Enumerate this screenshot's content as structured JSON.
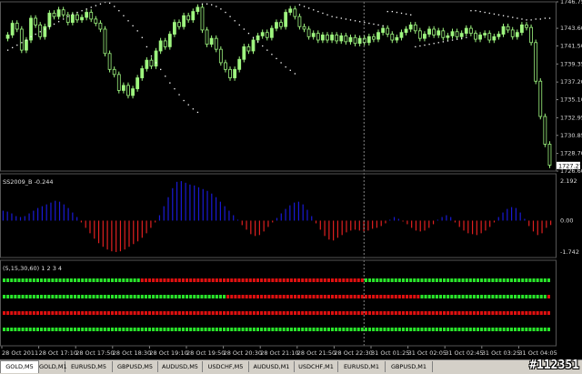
{
  "colors": {
    "background": "#000000",
    "grid": "#555555",
    "candle": "#9ef57f",
    "sar": "#ffffff",
    "histogram_up": "#1a1ad6",
    "histogram_down": "#e02020",
    "dot_green": "#29e62b",
    "dot_red": "#e01010",
    "cursor_line": "#bbbbbb"
  },
  "price_pane": {
    "price_labels": [
      "1746.75",
      "1743.60",
      "1741.50",
      "1739.35",
      "1737.20",
      "1735.10",
      "1732.95",
      "1730.85",
      "1728.70",
      "1726.60"
    ],
    "current_price": "1727.27"
  },
  "indicator_pane": {
    "title": "SS2009_B -0.244",
    "labels": [
      "2.192",
      "0.00",
      "-1.742"
    ]
  },
  "dots_pane": {
    "title": "(5,15,30,60) 1 2 3 4"
  },
  "time_labels": [
    "28 Oct 2011",
    "28 Oct 17:10",
    "28 Oct 17:50",
    "28 Oct 18:30",
    "28 Oct 19:10",
    "28 Oct 19:50",
    "28 Oct 20:30",
    "28 Oct 21:10",
    "28 Oct 21:50",
    "28 Oct 22:30",
    "31 Oct 01:25",
    "31 Oct 02:05",
    "31 Oct 02:45",
    "31 Oct 03:25",
    "31 Oct 04:05"
  ],
  "tabs": [
    {
      "label": "GOLD,M5",
      "active": true
    },
    {
      "label": "GOLD,M1",
      "active": false
    },
    {
      "label": "EURUSD,M5",
      "active": false
    },
    {
      "label": "GBPUSD,M5",
      "active": false
    },
    {
      "label": "AUDUSD,M5",
      "active": false
    },
    {
      "label": "USDCHF,M5",
      "active": false
    },
    {
      "label": "AUDUSD,M1",
      "active": false
    },
    {
      "label": "USDCHF,M1",
      "active": false
    },
    {
      "label": "EURUSD,M1",
      "active": false
    },
    {
      "label": "GBPUSD,M1",
      "active": false
    }
  ],
  "watermark": "#112351",
  "chart_data": {
    "type": "candlestick",
    "y_range": [
      1726.6,
      1746.75
    ],
    "closes": [
      1742.8,
      1744.2,
      1743.5,
      1741.0,
      1742.2,
      1744.8,
      1744.0,
      1742.6,
      1743.8,
      1745.4,
      1745.0,
      1745.8,
      1745.2,
      1744.3,
      1745.2,
      1744.6,
      1744.9,
      1745.5,
      1744.7,
      1744.2,
      1743.5,
      1740.6,
      1738.7,
      1738.1,
      1736.2,
      1736.8,
      1735.6,
      1736.4,
      1737.7,
      1738.8,
      1739.8,
      1739.1,
      1740.9,
      1742.1,
      1741.4,
      1742.9,
      1744.3,
      1743.8,
      1745.1,
      1744.6,
      1745.6,
      1746.1,
      1743.4,
      1741.7,
      1742.4,
      1741.1,
      1739.5,
      1738.7,
      1737.7,
      1738.7,
      1739.9,
      1741.4,
      1740.9,
      1742.2,
      1742.7,
      1743.1,
      1742.5,
      1743.6,
      1744.3,
      1743.8,
      1745.5,
      1745.9,
      1745.0,
      1743.8,
      1743.5,
      1742.6,
      1743.0,
      1742.2,
      1742.8,
      1742.2,
      1742.8,
      1742.1,
      1742.7,
      1742.0,
      1742.5,
      1741.8,
      1742.4,
      1741.9,
      1742.6,
      1742.3,
      1743.1,
      1743.6,
      1742.9,
      1742.2,
      1742.5,
      1743.1,
      1743.5,
      1744.0,
      1743.3,
      1742.4,
      1742.9,
      1743.5,
      1742.8,
      1743.3,
      1742.5,
      1742.7,
      1743.2,
      1742.6,
      1743.0,
      1743.6,
      1743.0,
      1742.3,
      1742.8,
      1743.0,
      1742.2,
      1742.6,
      1742.9,
      1743.8,
      1743.4,
      1742.6,
      1743.1,
      1744.0,
      1743.7,
      1741.9,
      1737.3,
      1733.1,
      1729.8,
      1727.3
    ],
    "sar": [
      1741.0,
      1741.3,
      1741.6,
      1741.9,
      1742.2,
      1742.6,
      1742.9,
      1743.2,
      1743.5,
      1743.8,
      1744.1,
      1744.4,
      1744.7,
      1745.0,
      1745.3,
      1745.5,
      1745.7,
      1745.9,
      1746.1,
      1746.3,
      1746.5,
      1746.7,
      1746.6,
      1746.2,
      1745.7,
      1745.1,
      1744.5,
      1743.9,
      1743.3,
      1742.5,
      1741.4,
      1740.3,
      1739.5,
      1738.7,
      1737.9,
      1737.1,
      1736.4,
      1735.7,
      1735.0,
      1734.5,
      1734.0,
      1733.6,
      1746.5,
      1746.5,
      1746.4,
      1746.2,
      1745.9,
      1745.5,
      1745.0,
      1744.5,
      1744.0,
      1743.5,
      1743.0,
      1742.5,
      1742.0,
      1741.5,
      1741.0,
      1740.5,
      1740.0,
      1739.5,
      1739.0,
      1738.6,
      1738.2,
      1746.4,
      1746.2,
      1746.0,
      1745.8,
      1745.6,
      1745.4,
      1745.2,
      1745.0,
      1744.9,
      1744.8,
      1744.7,
      1744.6,
      1744.5,
      1744.4,
      1744.3,
      1744.2,
      1744.1,
      1744.0,
      1743.9,
      1745.6,
      1745.6,
      1745.5,
      1745.4,
      1745.3,
      1745.2,
      1741.4,
      1741.5,
      1741.6,
      1741.7,
      1741.8,
      1741.9,
      1742.0,
      1742.1,
      1742.2,
      1742.3,
      1742.4,
      1742.5,
      1745.7,
      1745.7,
      1745.6,
      1745.5,
      1745.4,
      1745.3,
      1745.2,
      1745.1,
      1745.0,
      1744.9,
      1744.8,
      1744.7,
      1744.6,
      1744.6,
      1744.7,
      1744.7,
      1744.8,
      1744.8
    ],
    "histogram": [
      0.55,
      0.5,
      0.4,
      0.25,
      0.2,
      0.25,
      0.4,
      0.55,
      0.7,
      0.8,
      0.9,
      1.0,
      1.1,
      1.05,
      0.9,
      0.7,
      0.45,
      0.2,
      -0.1,
      -0.4,
      -0.7,
      -1.0,
      -1.25,
      -1.45,
      -1.6,
      -1.7,
      -1.74,
      -1.7,
      -1.6,
      -1.45,
      -1.3,
      -1.15,
      -0.95,
      -0.7,
      -0.4,
      -0.1,
      0.3,
      0.8,
      1.3,
      1.8,
      2.15,
      2.19,
      2.1,
      2.0,
      1.95,
      1.85,
      1.75,
      1.65,
      1.5,
      1.3,
      1.05,
      0.8,
      0.55,
      0.3,
      0.05,
      -0.25,
      -0.5,
      -0.75,
      -0.85,
      -0.8,
      -0.6,
      -0.35,
      -0.1,
      0.15,
      0.4,
      0.65,
      0.85,
      1.0,
      1.05,
      0.9,
      0.6,
      0.25,
      -0.15,
      -0.5,
      -0.85,
      -1.05,
      -1.1,
      -0.95,
      -0.8,
      -0.65,
      -0.55,
      -0.5,
      -0.55,
      -0.6,
      -0.55,
      -0.45,
      -0.4,
      -0.3,
      -0.15,
      0.05,
      0.2,
      0.1,
      -0.05,
      -0.2,
      -0.4,
      -0.55,
      -0.6,
      -0.55,
      -0.4,
      -0.2,
      0.05,
      0.2,
      0.3,
      0.2,
      -0.1,
      -0.35,
      -0.55,
      -0.7,
      -0.75,
      -0.8,
      -0.7,
      -0.55,
      -0.35,
      -0.1,
      0.2,
      0.45,
      0.65,
      0.75,
      0.7,
      0.45,
      0.1,
      -0.3,
      -0.6,
      -0.8,
      -0.7,
      -0.4,
      -0.244
    ],
    "histogram_range": [
      -1.742,
      2.192
    ],
    "dot_rows": [
      {
        "name": "1",
        "segments": [
          [
            "green",
            37
          ],
          [
            "red",
            60
          ],
          [
            "green",
            50
          ]
        ]
      },
      {
        "name": "2",
        "segments": [
          [
            "green",
            60
          ],
          [
            "red",
            52
          ],
          [
            "green",
            34
          ],
          [
            "red",
            1
          ]
        ]
      },
      {
        "name": "3",
        "segments": [
          [
            "red",
            147
          ]
        ]
      },
      {
        "name": "4",
        "segments": [
          [
            "green",
            147
          ]
        ]
      }
    ],
    "cursor_x_fraction": 0.655
  }
}
